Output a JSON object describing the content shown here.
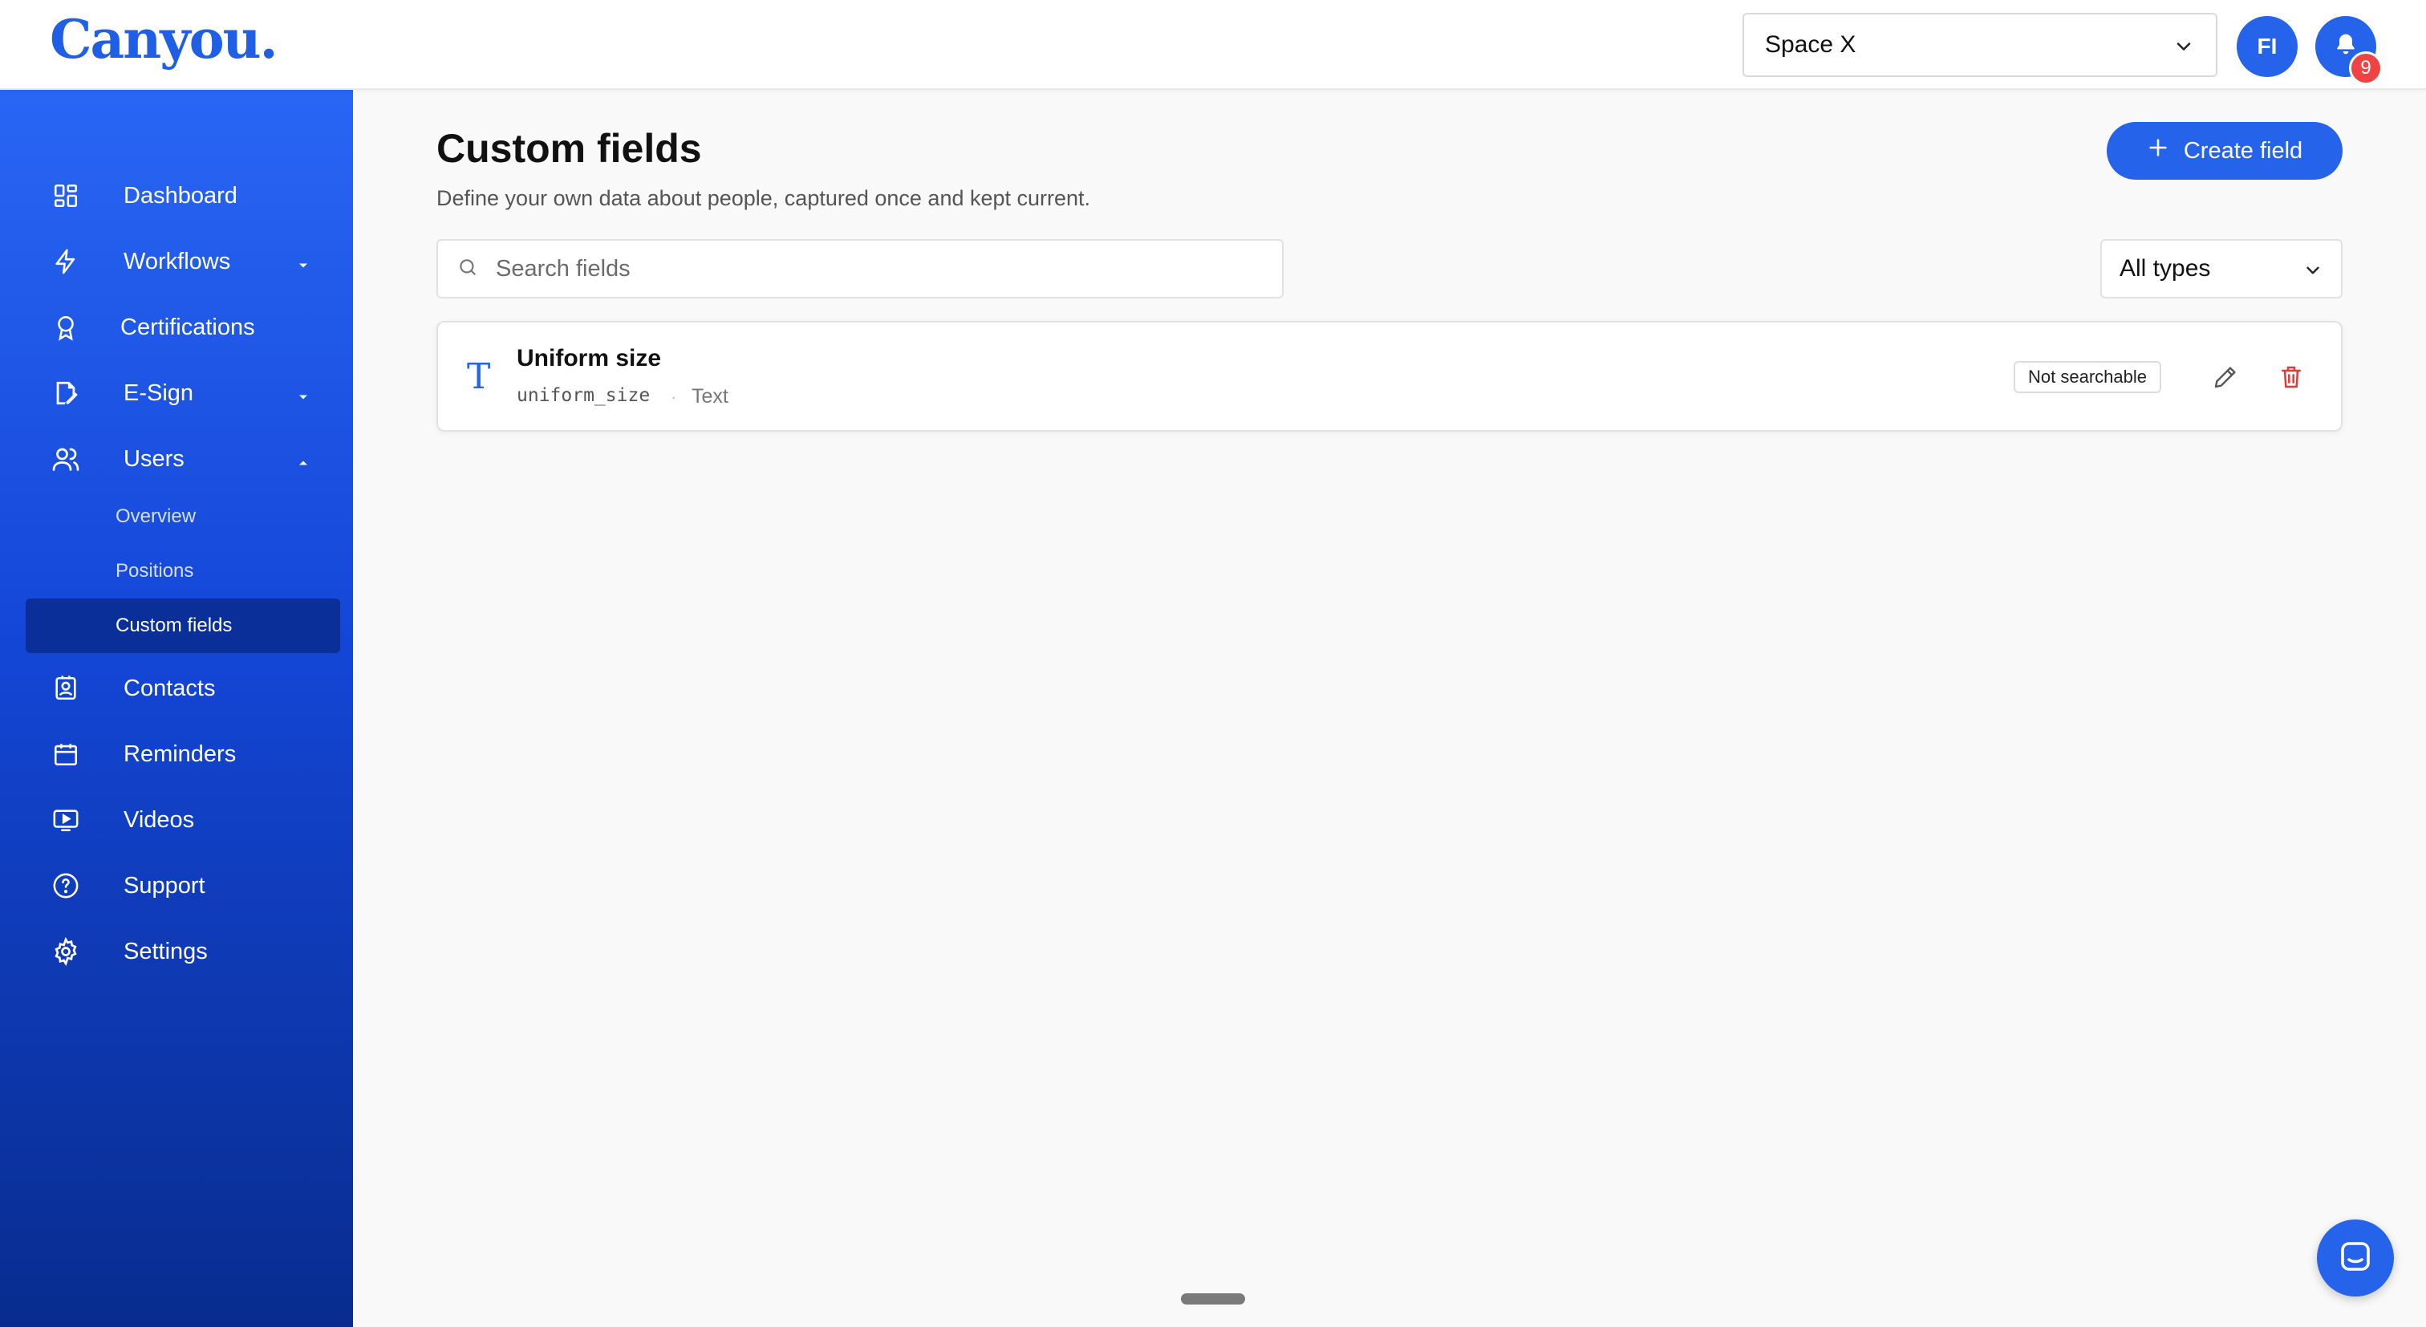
{
  "app": {
    "logo": "Canyou."
  },
  "header": {
    "space_select": {
      "value": "Space X"
    },
    "user_initials": "FI",
    "notification_count": "9"
  },
  "sidebar": {
    "items": [
      {
        "label": "Dashboard",
        "icon": "grid-icon"
      },
      {
        "label": "Workflows",
        "icon": "lightning-icon",
        "expandable": true,
        "expanded": false
      },
      {
        "label": "Certifications",
        "icon": "award-icon"
      },
      {
        "label": "E-Sign",
        "icon": "document-sign-icon",
        "expandable": true,
        "expanded": false
      },
      {
        "label": "Users",
        "icon": "users-icon",
        "expandable": true,
        "expanded": true,
        "children": [
          {
            "label": "Overview"
          },
          {
            "label": "Positions"
          },
          {
            "label": "Custom fields",
            "active": true
          }
        ]
      },
      {
        "label": "Contacts",
        "icon": "contact-card-icon"
      },
      {
        "label": "Reminders",
        "icon": "calendar-icon"
      },
      {
        "label": "Videos",
        "icon": "video-icon"
      },
      {
        "label": "Support",
        "icon": "help-circle-icon"
      },
      {
        "label": "Settings",
        "icon": "gear-icon"
      }
    ]
  },
  "main": {
    "title": "Custom fields",
    "subtitle": "Define your own data about people, captured once and kept current.",
    "create_button_label": "Create field",
    "search": {
      "placeholder": "Search fields",
      "value": ""
    },
    "type_filter": {
      "value": "All types"
    },
    "fields": [
      {
        "name": "Uniform size",
        "key": "uniform_size",
        "separator": "·",
        "type": "Text",
        "badge": "Not searchable",
        "icon": "text-type-icon"
      }
    ]
  },
  "colors": {
    "brand": "#2563eb",
    "sidebar_top": "#2966f5",
    "sidebar_bottom": "#082c8e",
    "danger": "#ef4444"
  }
}
